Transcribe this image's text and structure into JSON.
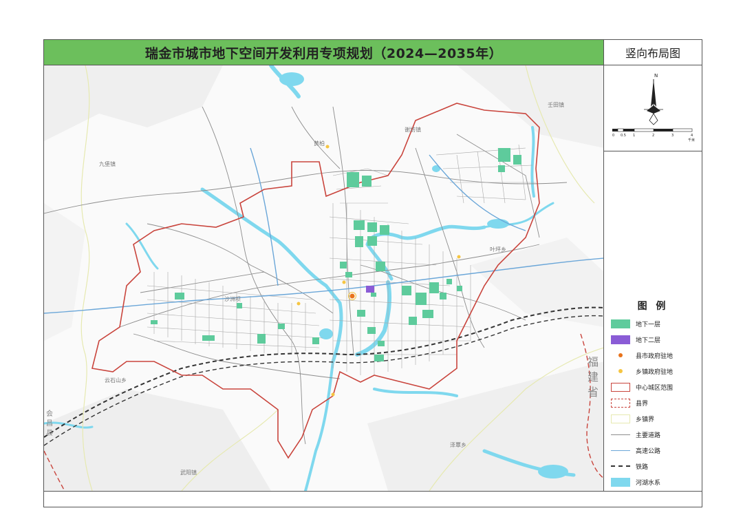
{
  "header": {
    "title": "瑞金市城市地下空间开发利用专项规划（2024—2035年）",
    "subtitle": "竖向布局图"
  },
  "compass": {
    "north_letter": "N",
    "scale_ticks": [
      "0",
      "0.5",
      "1",
      "2",
      "3",
      "4"
    ],
    "scale_unit": "千米"
  },
  "legend": {
    "title": "图 例",
    "items": [
      {
        "label": "地下一层",
        "swatch": "fill",
        "color": "#5ecb9c"
      },
      {
        "label": "地下二层",
        "swatch": "fill",
        "color": "#8a5cd6"
      },
      {
        "label": "县市政府驻地",
        "swatch": "dot",
        "color": "#e8731c"
      },
      {
        "label": "乡镇政府驻地",
        "swatch": "dot",
        "color": "#f5c542"
      },
      {
        "label": "中心城区范围",
        "swatch": "outline",
        "color": "#c9443c"
      },
      {
        "label": "县界",
        "swatch": "dash-outline",
        "color": "#c9443c"
      },
      {
        "label": "乡镇界",
        "swatch": "outline",
        "color": "#e6e9b0"
      },
      {
        "label": "主要道路",
        "swatch": "line",
        "color": "#8c8c8c"
      },
      {
        "label": "高速公路",
        "swatch": "line",
        "color": "#6aa6d8"
      },
      {
        "label": "铁路",
        "swatch": "rail",
        "color": "#333333"
      },
      {
        "label": "河湖水系",
        "swatch": "fill",
        "color": "#7fd8ee"
      }
    ]
  },
  "map": {
    "place_labels": [
      "九堡镇",
      "叶坪乡",
      "黄柏",
      "壬田镇",
      "沙洲坝",
      "云石山乡",
      "武阳镇",
      "泽覃乡",
      "谢坊镇"
    ],
    "province_label": "福建省",
    "county_label": "会昌县",
    "colors": {
      "water": "#7fd8ee",
      "b1": "#5ecb9c",
      "b2": "#8a5cd6",
      "boundary": "#c9443c",
      "road": "#8c8c8c",
      "highway": "#6aa6d8",
      "rail": "#333333",
      "terrain": "#ececec"
    }
  }
}
